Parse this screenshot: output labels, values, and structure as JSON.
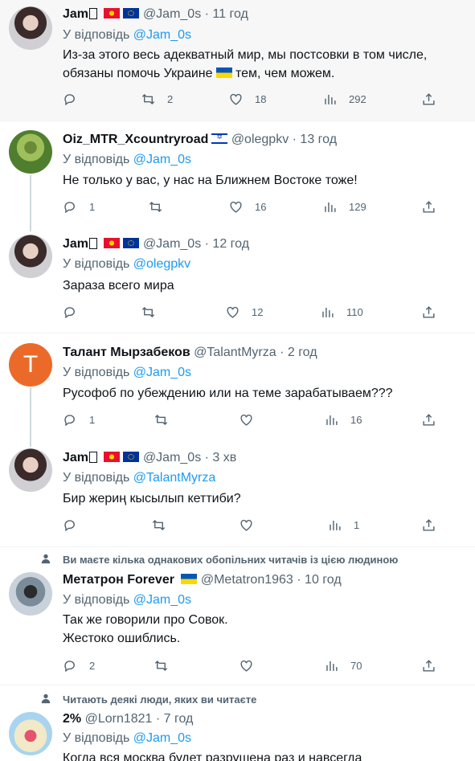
{
  "tweets": [
    {
      "name": "Jam",
      "flags": [
        "kg",
        "eu"
      ],
      "handle": "@Jam_0s",
      "time": "· 11 год",
      "reply_prefix": "У відповідь",
      "reply_handle": "@Jam_0s",
      "text_line1": "Из-за этого весь адекватный мир, мы постсовки в том числе,",
      "text_line2a": "обязаны помочь Украине",
      "text_line2b": " тем, чем можем.",
      "replies": "",
      "retweets": "2",
      "likes": "18",
      "views": "292"
    },
    {
      "name": "Oiz_MTR_Xcountryroad",
      "handle": "@olegpkv",
      "time": "· 13 год",
      "reply_prefix": "У відповідь",
      "reply_handle": "@Jam_0s",
      "text_line1": "Не только у вас, у нас на Ближнем Востоке тоже!",
      "replies": "1",
      "retweets": "",
      "likes": "16",
      "views": "129"
    },
    {
      "name": "Jam",
      "handle": "@Jam_0s",
      "time": "· 12 год",
      "reply_prefix": "У відповідь",
      "reply_handle": "@olegpkv",
      "text_line1": "Зараза всего мира",
      "replies": "",
      "retweets": "",
      "likes": "12",
      "views": "110"
    },
    {
      "name": "Талант Мырзабеков",
      "avatar_letter": "T",
      "handle": "@TalantMyrza",
      "time": "· 2 год",
      "reply_prefix": "У відповідь",
      "reply_handle": "@Jam_0s",
      "text_line1": "Русофоб по убеждению или на теме зарабатываем???",
      "replies": "1",
      "retweets": "",
      "likes": "",
      "views": "16"
    },
    {
      "name": "Jam",
      "handle": "@Jam_0s",
      "time": "· 3 хв",
      "reply_prefix": "У відповідь",
      "reply_handle": "@TalantMyrza",
      "text_line1": "Бир жериң кысылып кеттиби?",
      "replies": "",
      "retweets": "",
      "likes": "",
      "views": "1"
    },
    {
      "social_context": "Ви маєте кілька однакових обопільних читачів із цією людиною",
      "name": "Метатрон Forever",
      "handle": "@Metatron1963",
      "time": "· 10 год",
      "reply_prefix": "У відповідь",
      "reply_handle": "@Jam_0s",
      "text_line1": "Так же говорили про Совок.",
      "text_line2": "Жестоко ошиблись.",
      "replies": "2",
      "retweets": "",
      "likes": "",
      "views": "70"
    },
    {
      "social_context": "Читають деякі люди, яких ви читаєте",
      "name": "2%",
      "handle": "@Lorn1821",
      "time": "· 7 год",
      "reply_prefix": "У відповідь",
      "reply_handle": "@Jam_0s",
      "text_line1": "Когда вся москва будет разрушена раз и навсегда"
    }
  ],
  "colors": {
    "link": "#1d9bf0",
    "secondary": "#536471",
    "highlight_bg": "#f7f7f7",
    "thread_line": "#cfd9de"
  },
  "icons": [
    "reply-icon",
    "retweet-icon",
    "like-icon",
    "views-icon",
    "share-icon",
    "person-icon"
  ]
}
